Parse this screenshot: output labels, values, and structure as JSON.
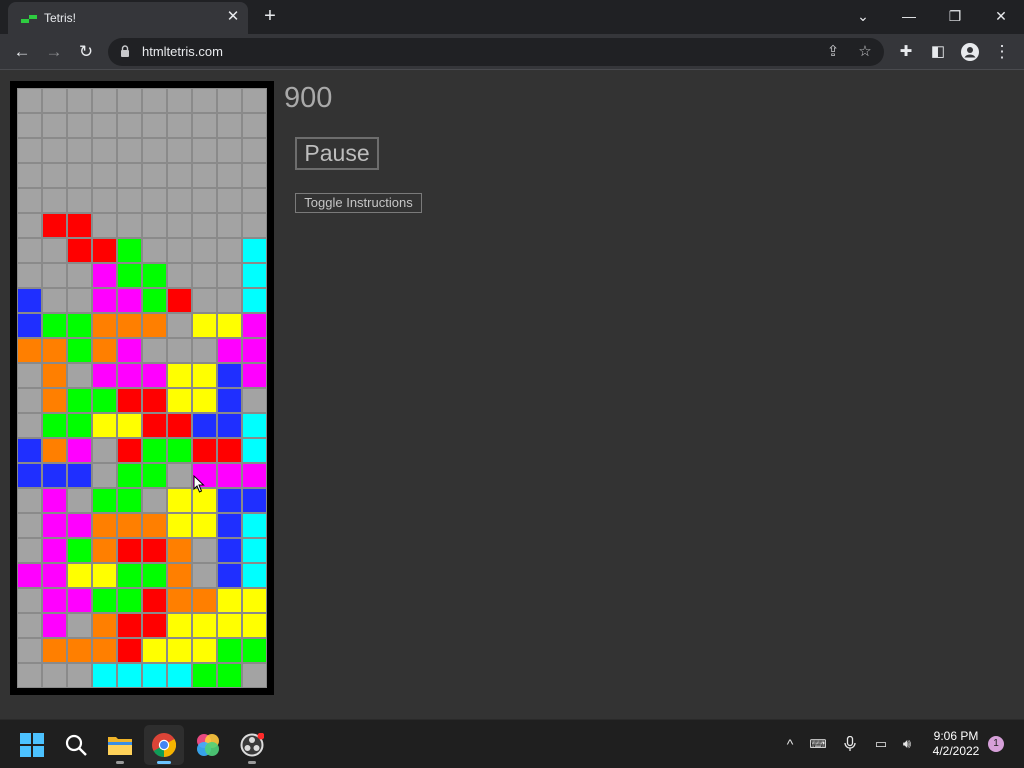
{
  "browser": {
    "tab_title": "Tetris!",
    "url": "htmltetris.com",
    "icons": {
      "tab_close": "close-icon",
      "new_tab": "plus-icon",
      "back": "arrow-left-icon",
      "forward": "arrow-right-icon",
      "reload": "reload-icon",
      "share": "share-icon",
      "bookmark": "star-icon",
      "extensions": "puzzle-icon",
      "side_panel": "side-panel-icon",
      "profile": "profile-icon",
      "menu": "kebab-menu-icon"
    }
  },
  "game": {
    "score": "900",
    "pause_label": "Pause",
    "instructions_label": "Toggle Instructions",
    "colors": {
      "0": "#a3a3a3",
      "R": "#ff0000",
      "G": "#00ff00",
      "B": "#1f2fff",
      "C": "#00ffff",
      "M": "#ff00ff",
      "Y": "#ffff00",
      "O": "#ff7f00"
    },
    "board": [
      "0000000000",
      "0000000000",
      "0000000000",
      "0000000000",
      "0000000000",
      "0RR0000000",
      "00RRG0000C",
      "000MGG000C",
      "B00MMGR00C",
      "BGGOOO0YYM",
      "OOGOM000MM",
      "0O0MMMYYBM",
      "0OGGRRYYB0",
      "0GGYYRRBBC",
      "BOM0RGGRRC",
      "BBB0GG0MMM",
      "0M0GG0YYBB",
      "0MMOOOYYBC",
      "0MGORRO0BC",
      "MMYYGGO0BC",
      "0MMGGROOYY",
      "0M0ORRYYYY",
      "0OOORYYYGG",
      "000CCCCGG0"
    ]
  },
  "taskbar": {
    "apps": [
      "windows-start",
      "search",
      "file-explorer",
      "chrome",
      "photos",
      "obs-studio"
    ],
    "time": "9:06 PM",
    "date": "4/2/2022",
    "notification_count": "1"
  }
}
